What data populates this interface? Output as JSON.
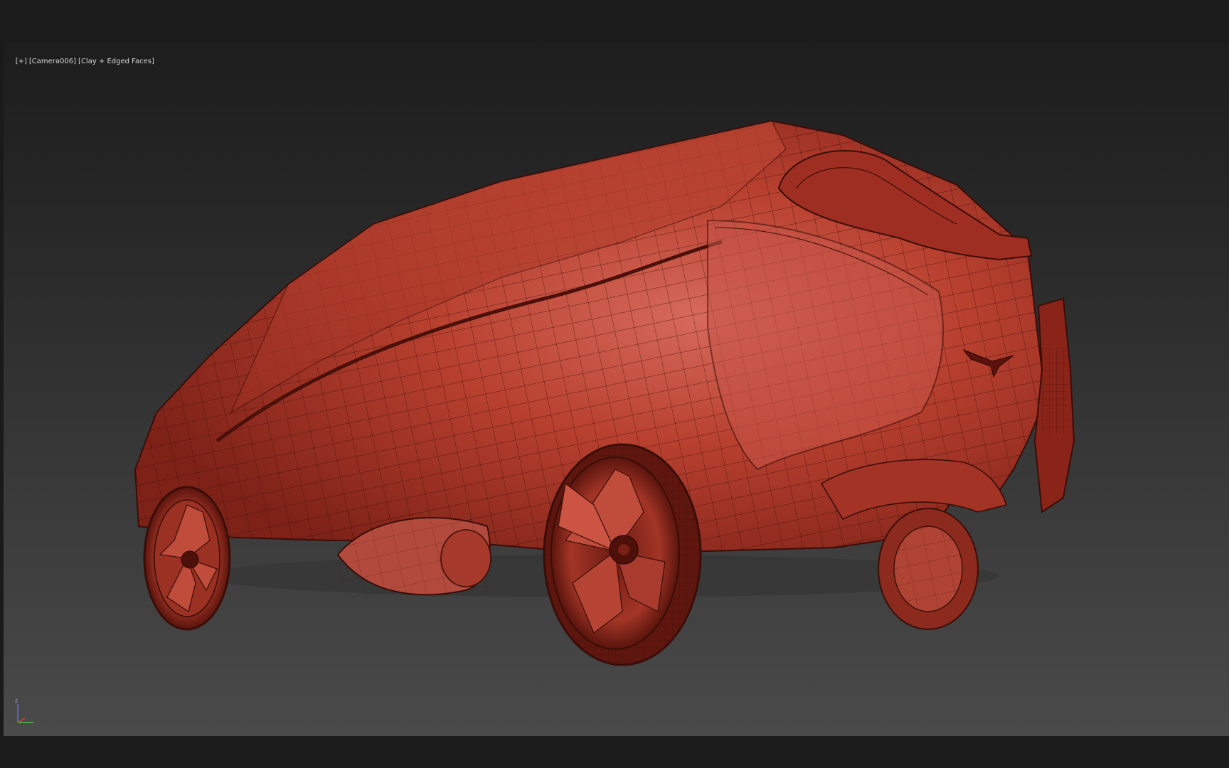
{
  "viewport": {
    "label_plus": "[+]",
    "label_camera": "[Camera006]",
    "label_shading": "[Clay + Edged Faces]",
    "background_top": "#1d1d1d",
    "background_bottom": "#4a4a4a",
    "model_color": "#b43c2e",
    "wire_color": "#3a0d08"
  },
  "gizmo": {
    "axis_z_label": "z"
  }
}
